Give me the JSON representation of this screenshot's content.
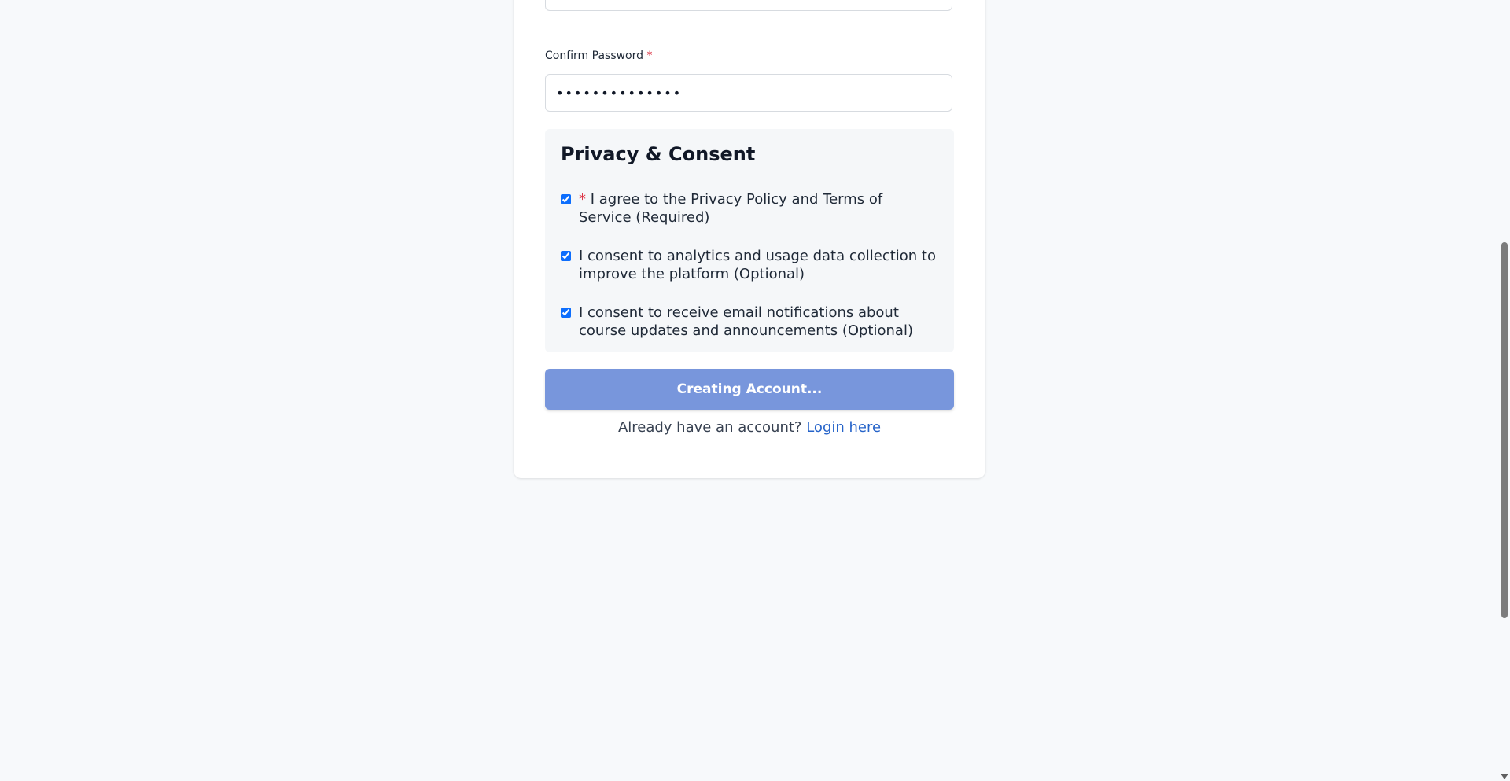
{
  "form": {
    "password_value": "••••••••••••••",
    "confirm_password": {
      "label": "Confirm Password",
      "required_marker": "*",
      "value": "••••••••••••••"
    }
  },
  "consent": {
    "title": "Privacy & Consent",
    "items": [
      {
        "required_marker": "*",
        "text": "I agree to the Privacy Policy and Terms of Service (Required)",
        "checked": true
      },
      {
        "text": "I consent to analytics and usage data collection to improve the platform (Optional)",
        "checked": true
      },
      {
        "text": "I consent to receive email notifications about course updates and announcements (Optional)",
        "checked": true
      }
    ]
  },
  "submit": {
    "label": "Creating Account..."
  },
  "login_prompt": {
    "text": "Already have an account?",
    "link_label": "Login here"
  },
  "colors": {
    "accent": "#2563c9",
    "button_disabled": "#7896dc",
    "required": "#dc3545",
    "page_background": "#f7f9fb"
  }
}
